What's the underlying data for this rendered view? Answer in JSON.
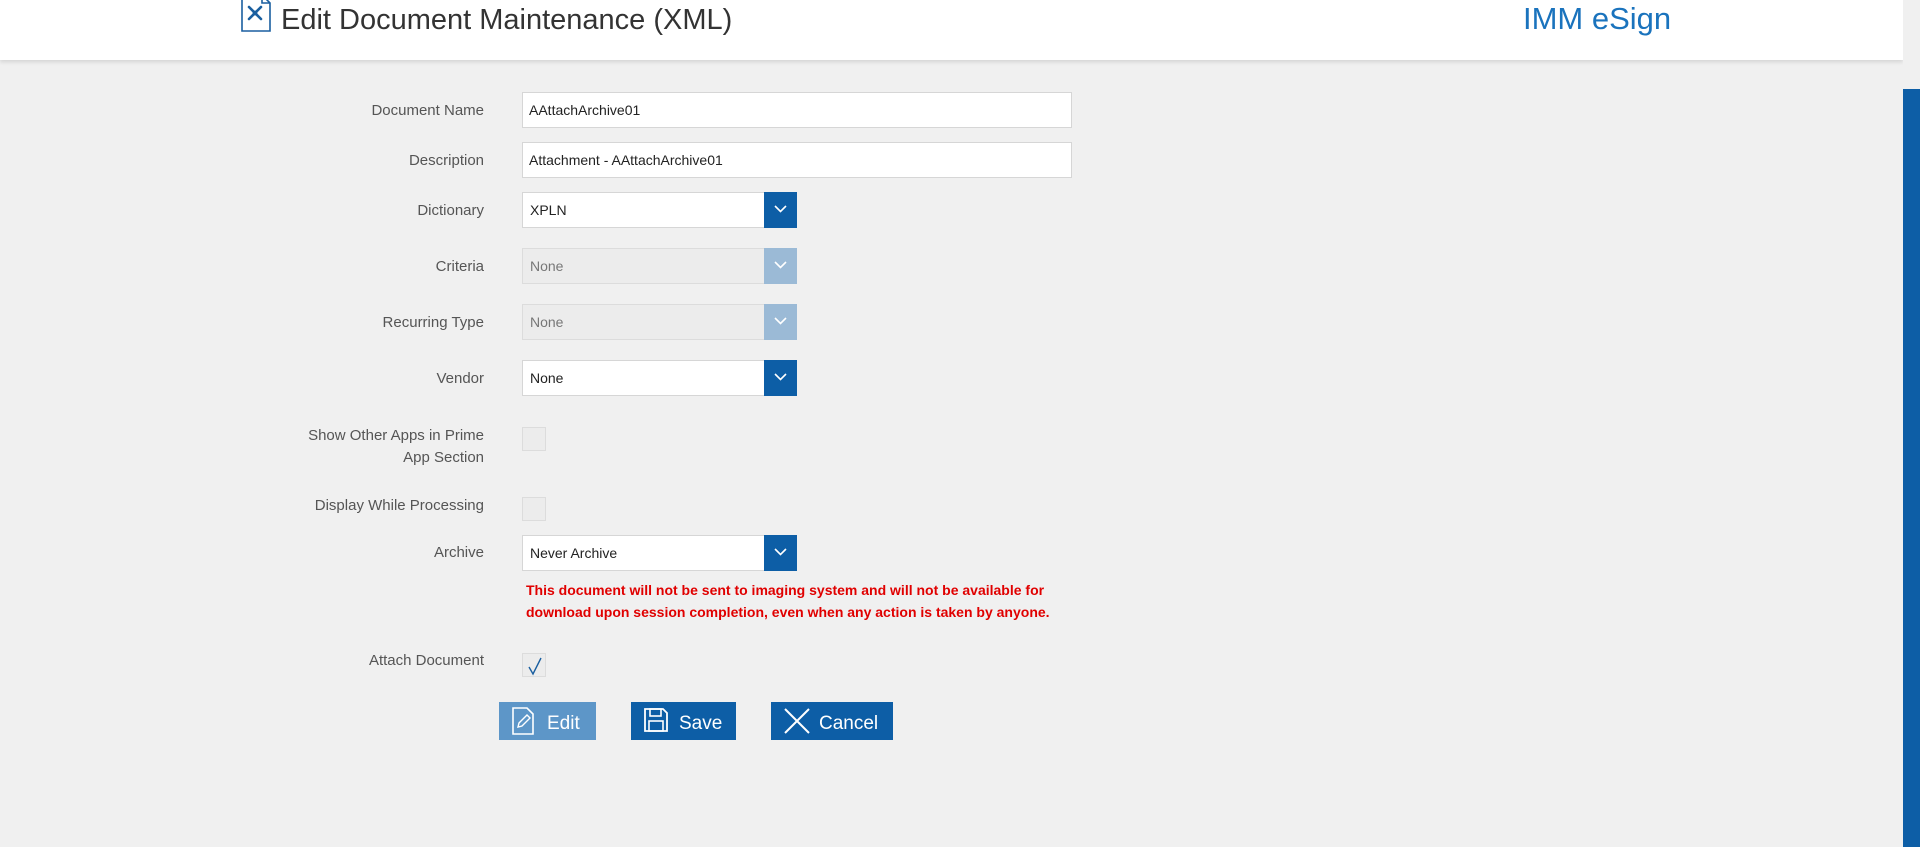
{
  "header": {
    "title": "Edit Document Maintenance (XML)",
    "brand": "IMM eSign",
    "icon": "document-gear-icon"
  },
  "form": {
    "document_name": {
      "label": "Document Name",
      "value": "AAttachArchive01"
    },
    "description": {
      "label": "Description",
      "value": "Attachment  - AAttachArchive01"
    },
    "dictionary": {
      "label": "Dictionary",
      "value": "XPLN"
    },
    "criteria": {
      "label": "Criteria",
      "value": "None",
      "disabled": true
    },
    "recurring_type": {
      "label": "Recurring Type",
      "value": "None",
      "disabled": true
    },
    "vendor": {
      "label": "Vendor",
      "value": "None"
    },
    "show_other_apps": {
      "label_line1": "Show Other Apps in Prime",
      "label_line2": "App Section",
      "checked": false
    },
    "display_while_processing": {
      "label": "Display While Processing",
      "checked": false
    },
    "archive": {
      "label": "Archive",
      "value": "Never Archive",
      "warning_line1": "This document will not be sent to imaging system and will not be available for",
      "warning_line2": "download upon session completion, even when any action is taken by anyone."
    },
    "attach_document": {
      "label": "Attach Document",
      "checked": true
    }
  },
  "actions": {
    "edit_label": "Edit",
    "save_label": "Save",
    "cancel_label": "Cancel"
  },
  "colors": {
    "accent": "#0d5ea6",
    "accent_disabled": "#9bbad6",
    "warning": "#e00000",
    "brand": "#1a73bd"
  }
}
